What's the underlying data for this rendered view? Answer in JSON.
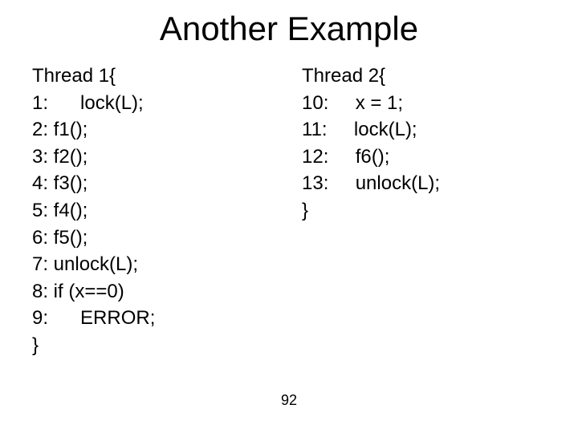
{
  "title": "Another Example",
  "thread1": {
    "open": "Thread 1{",
    "l1": "1:      lock(L);",
    "l2": "2: f1();",
    "l3": "3: f2();",
    "l4": "4: f3();",
    "l5": "5: f4();",
    "l6": "6: f5();",
    "l7": "7: unlock(L);",
    "l8": "8: if (x==0)",
    "l9": "9:      ERROR;",
    "close": "}"
  },
  "thread2": {
    "open": "Thread 2{",
    "l10": "10:     x = 1;",
    "l11": "11:     lock(L);",
    "l12": "12:     f6();",
    "l13": "13:     unlock(L);",
    "close": "}"
  },
  "page_number": "92"
}
